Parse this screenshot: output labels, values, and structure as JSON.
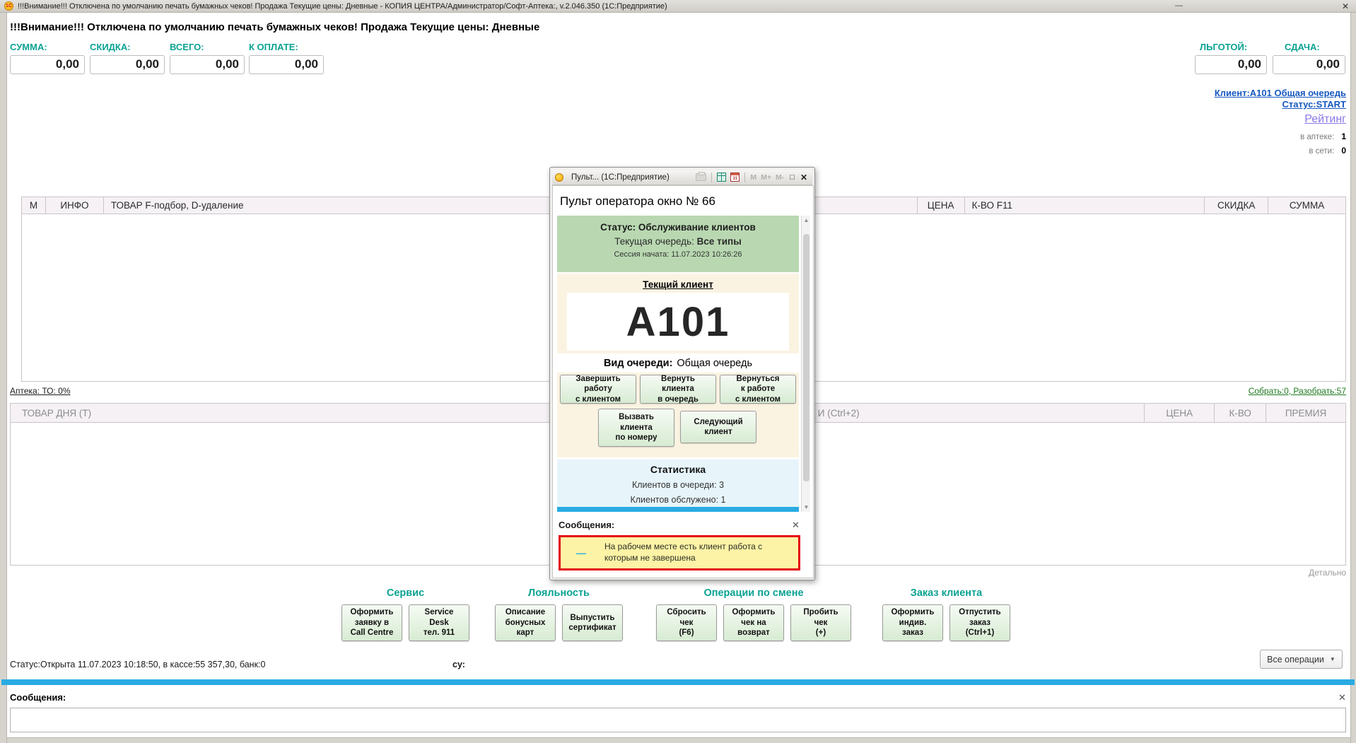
{
  "window": {
    "icon": "1С",
    "title": "!!!Внимание!!! Отключена по умолчанию печать бумажных чеков! Продажа Текущие цены: Дневные - КОПИЯ ЦЕНТРА/Администратор/Софт-Аптека:, v.2.046.350  (1С:Предприятие)",
    "minimize": "—",
    "close": "✕"
  },
  "header": {
    "warning": "!!!Внимание!!! Отключена по умолчанию печать бумажных чеков! Продажа Текущие цены: Дневные",
    "totals": [
      {
        "label": "СУММА:",
        "value": "0,00"
      },
      {
        "label": "СКИДКА:",
        "value": "0,00"
      },
      {
        "label": "ВСЕГО:",
        "value": "0,00"
      },
      {
        "label": "К ОПЛАТЕ:",
        "value": "0,00"
      },
      {
        "label": "ЛЬГОТОЙ:",
        "value": "0,00"
      },
      {
        "label": "СДАЧА:",
        "value": "0,00"
      }
    ],
    "client_link": "Клиент:A101 Общая очередь",
    "status_link": "Статус:START",
    "rating_link": "Рейтинг",
    "pharmacy_stat": {
      "label": "в аптеке:",
      "value": "1"
    },
    "network_stat": {
      "label": "в сети:",
      "value": "0"
    }
  },
  "sales_table": {
    "columns": [
      "М",
      "ИНФО",
      "ТОВАР  F-подбор, D-удаление",
      "ЦЕНА",
      "К-ВО F11",
      "СКИДКА",
      "СУММА"
    ]
  },
  "mid": {
    "pharmacy_link": "Аптека: ТО: 0%",
    "assembly_link": "Собрать:0, Разобрать:57"
  },
  "day_table": {
    "columns": [
      "ТОВАР ДНЯ (Т)",
      "И (Ctrl+2)",
      "ЦЕНА",
      "К-ВО",
      "ПРЕМИЯ"
    ],
    "detail_link": "Детально"
  },
  "operator_dialog": {
    "title": "Пульт...  (1С:Предприятие)",
    "toolbar": {
      "m": "M",
      "m_plus": "M+",
      "m_minus": "M-",
      "calendar_day": "31",
      "maximize": "□",
      "close": "✕"
    },
    "heading": "Пульт оператора окно № 66",
    "status_panel": {
      "status": "Статус: Обслуживание клиентов",
      "queue_label": "Текущая очередь:",
      "queue_value": "Все типы",
      "session_label": "Сессия начата:",
      "session_value": "11.07.2023 10:26:26"
    },
    "client_panel": {
      "caption": "Текщий клиент",
      "client": "A101",
      "queue_type_label": "Вид очереди:",
      "queue_type_value": "Общая очередь"
    },
    "buttons": {
      "finish": "Завершить\nработу\nс клиентом",
      "return_to_queue": "Вернуть\nклиента\nв очередь",
      "return_to_work": "Вернуться\nк работе\nс клиентом",
      "call_by_number": "Вызвать\nклиента\nпо номеру",
      "next_client": "Следующий\nклиент"
    },
    "stats_panel": {
      "title": "Статистика",
      "in_queue": "Клиентов в очереди: 3",
      "served": "Клиентов обслужено: 1"
    },
    "messages_label": "Сообщения:",
    "messages_close": "✕",
    "message_dash": "—",
    "message_text": "На рабочем месте есть клиент работа с которым не завершена"
  },
  "footer": {
    "groups": [
      {
        "title": "Сервис",
        "buttons": [
          {
            "label": "Оформить\nзаявку в\nCall Centre"
          },
          {
            "label": "Service\nDesk\nтел. 911"
          }
        ]
      },
      {
        "title": "Лояльность",
        "buttons": [
          {
            "label": "Описание\nбонусных\nкарт"
          },
          {
            "label": "Выпустить\nсертификат"
          }
        ]
      },
      {
        "title": "Операции по смене",
        "buttons": [
          {
            "label": "Сбросить\nчек\n(F6)"
          },
          {
            "label": "Оформить\nчек на\nвозврат"
          },
          {
            "label": "Пробить\nчек\n(+)"
          }
        ]
      },
      {
        "title": "Заказ клиента",
        "buttons": [
          {
            "label": "Оформить\nиндив.\nзаказ"
          },
          {
            "label": "Отпустить\nзаказ\n(Ctrl+1)"
          }
        ]
      }
    ],
    "status_line": "Статус:Открыта 11.07.2023 10:18:50, в кассе:55 357,30, банк:0",
    "su_label": "су:",
    "all_operations": "Все операции",
    "all_operations_caret": "▼",
    "messages_label": "Сообщения:",
    "messages_close": "✕"
  }
}
